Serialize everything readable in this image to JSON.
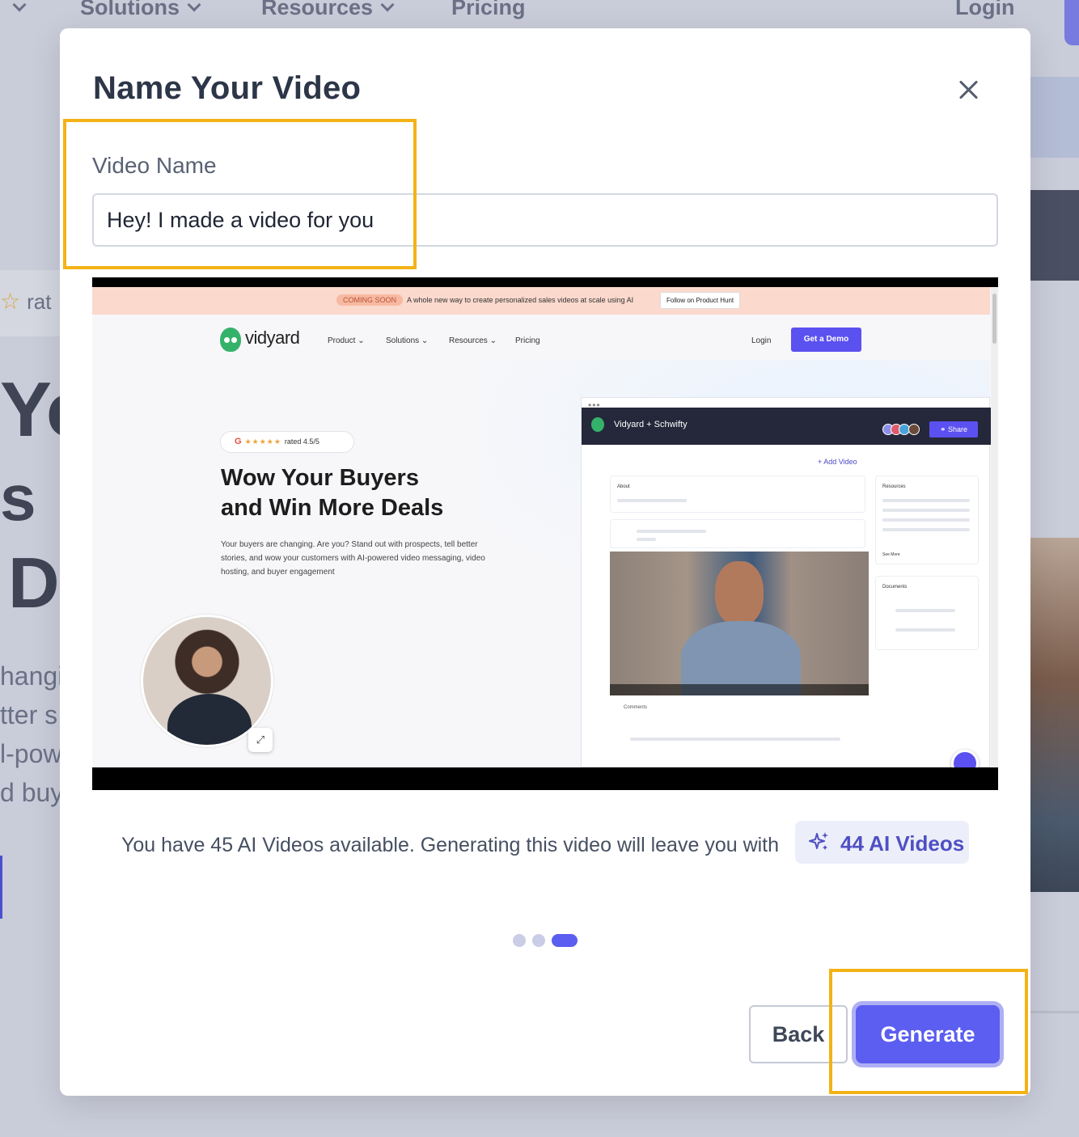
{
  "background": {
    "nav": {
      "solutions": "Solutions",
      "resources": "Resources",
      "pricing": "Pricing",
      "login": "Login"
    },
    "rated_fragment": "rat",
    "headline_fragments": [
      "Yo",
      "s",
      "D"
    ],
    "body_fragments": [
      "hangi",
      "tter s",
      "l-pow",
      "d buy"
    ]
  },
  "modal": {
    "title": "Name Your Video",
    "close_label": "×",
    "field_label": "Video Name",
    "video_name_value": "Hey! I made a video for you",
    "credits": {
      "text": "You have 45 AI Videos available. Generating this video will leave you with",
      "badge_label": "44 AI Videos",
      "badge_icon": "sparkle-icon",
      "available": 45,
      "remaining": 44
    },
    "pager": {
      "total": 3,
      "active": 3
    },
    "back_label": "Back",
    "generate_label": "Generate",
    "colors": {
      "primary": "#5b5ef0",
      "highlight": "#f3b316"
    }
  },
  "preview": {
    "banner": {
      "badge": "COMING SOON",
      "text": "A whole new way to create personalized sales videos at scale using AI",
      "button": "Follow on Product Hunt"
    },
    "logo": "vidyard",
    "nav": [
      "Product",
      "Solutions",
      "Resources",
      "Pricing"
    ],
    "login": "Login",
    "demo_button": "Get a Demo",
    "rated": "rated 4.5/5",
    "headline": "Wow Your Buyers\nand Win More Deals",
    "body": "Your buyers are changing. Are you? Stand out with prospects, tell better stories, and wow your customers with AI-powered video messaging, video hosting, and buyer engagement",
    "app": {
      "title": "Vidyard + Schwifty",
      "share": "Share",
      "add_video": "Add Video",
      "about": "About",
      "resources": "Resources",
      "documents": "Documents",
      "comments": "Comments",
      "see_more": "See More"
    }
  }
}
